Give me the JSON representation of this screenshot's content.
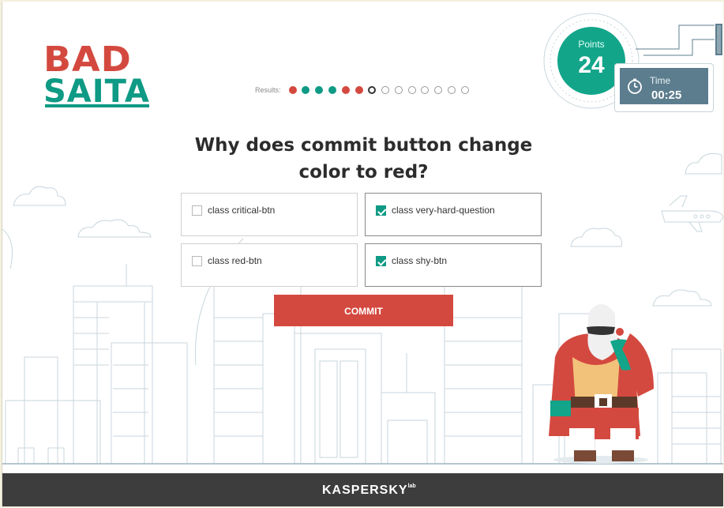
{
  "logo": {
    "line1": "BAD",
    "line2": "SAITA"
  },
  "results": {
    "label": "Results:",
    "dots": [
      "red",
      "green",
      "green",
      "green",
      "red",
      "red",
      "current",
      "empty",
      "empty",
      "empty",
      "empty",
      "empty",
      "empty",
      "empty"
    ]
  },
  "score": {
    "points_label": "Points",
    "points_value": "24"
  },
  "timer": {
    "label": "Time",
    "value": "00:25"
  },
  "question": {
    "text": "Why does commit button change color to red?"
  },
  "answers": [
    {
      "label": "class critical-btn",
      "checked": false
    },
    {
      "label": "class very-hard-question",
      "checked": true
    },
    {
      "label": "class red-btn",
      "checked": false
    },
    {
      "label": "class shy-btn",
      "checked": true
    }
  ],
  "commit": {
    "label": "COMMIT"
  },
  "footer": {
    "brand": "KASPERSKY",
    "brand_suffix": "lab"
  },
  "colors": {
    "brand_red": "#d4493f",
    "brand_green": "#0e9a84",
    "timer_bg": "#5c7d8e",
    "footer_bg": "#3d3d3d"
  }
}
